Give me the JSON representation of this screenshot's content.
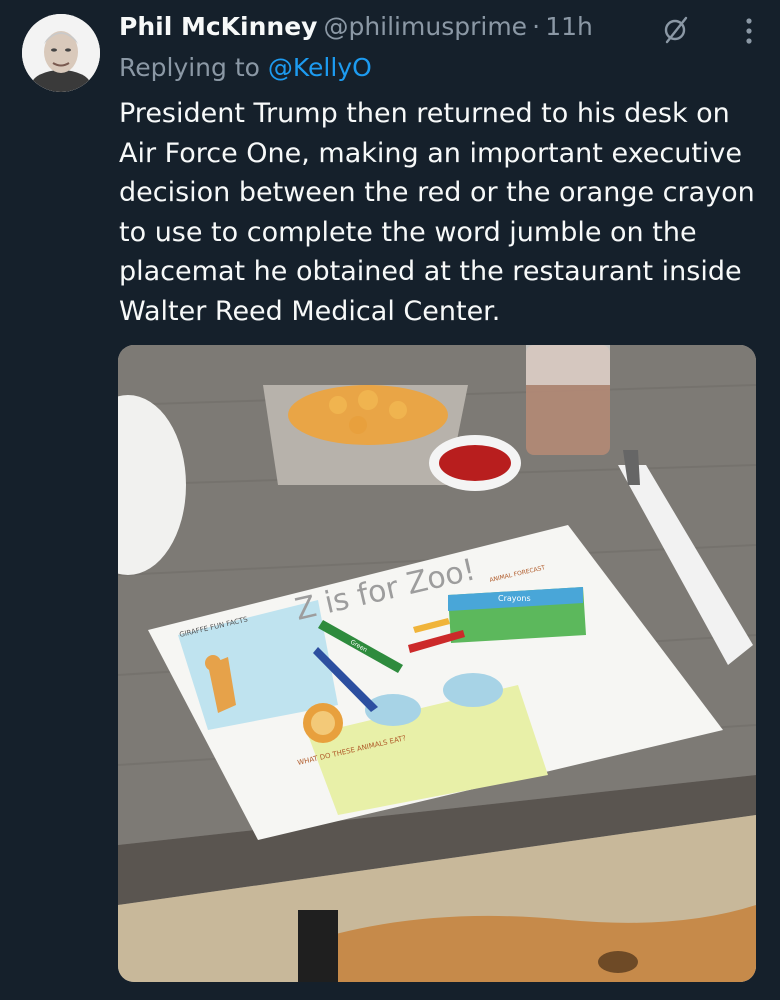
{
  "tweet": {
    "author_name": "Phil McKinney",
    "author_handle": "@philimusprime",
    "separator": "·",
    "timestamp": "11h",
    "reply_prefix": "Replying to",
    "reply_to": "@KellyO",
    "text": "President Trump then returned to his desk on Air Force One, making an important executive decision between the red or the orange crayon to use to complete the word jumble on the placemat he obtained at the restaurant inside Walter Reed Medical Center."
  },
  "icons": {
    "grok": "slash-circle-icon",
    "more": "more-vertical-icon"
  },
  "media": {
    "placemat_title": "Z is for Zoo!",
    "giraffe_heading": "GIRAFFE FUN FACTS",
    "animal_heading": "ANIMAL FORECAST",
    "question": "WHAT DO THESE ANIMALS EAT?",
    "crayon_box": "Crayons",
    "crayon_label": "Green"
  },
  "colors": {
    "background": "#15202b",
    "accent": "#1d9bf0",
    "secondary_text": "#8b98a5"
  }
}
